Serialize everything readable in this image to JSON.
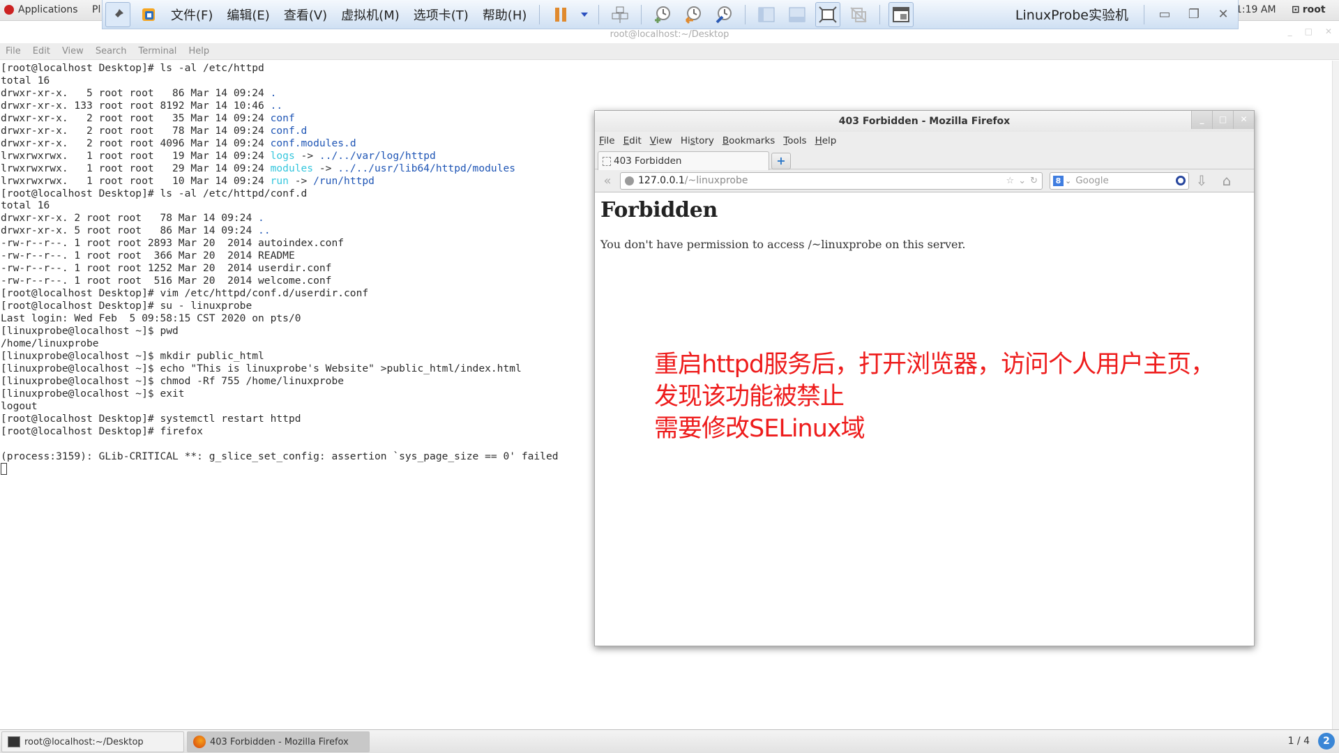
{
  "gnome_topbar": {
    "applications": "Applications",
    "places_truncated": "Pl",
    "clock": "1:19 AM",
    "user": "root"
  },
  "vm_toolbar": {
    "menus": [
      "文件(F)",
      "编辑(E)",
      "查看(V)",
      "虚拟机(M)",
      "选项卡(T)",
      "帮助(H)"
    ],
    "title": "LinuxProbe实验机",
    "icons": [
      "pin-icon",
      "vmware-logo-icon",
      "pause-icon",
      "dropdown-arrow-icon",
      "send-ctrl-alt-del-icon",
      "snapshot-take-icon",
      "snapshot-revert-icon",
      "snapshot-manager-icon",
      "sidebar-view-icon",
      "thumbnail-view-icon",
      "fullscreen-icon",
      "unity-icon",
      "console-view-icon"
    ],
    "minimize": "▭",
    "restore": "❐",
    "close": "✕"
  },
  "terminal": {
    "title": "root@localhost:~/Desktop",
    "menu": [
      "File",
      "Edit",
      "View",
      "Search",
      "Terminal",
      "Help"
    ],
    "lines": [
      [
        {
          "t": "[root@localhost Desktop]# ls -al /etc/httpd"
        }
      ],
      [
        {
          "t": "total 16"
        }
      ],
      [
        {
          "t": "drwxr-xr-x.   5 root root   86 Mar 14 09:24 "
        },
        {
          "t": ".",
          "c": "dir"
        }
      ],
      [
        {
          "t": "drwxr-xr-x. 133 root root 8192 Mar 14 10:46 "
        },
        {
          "t": "..",
          "c": "dir"
        }
      ],
      [
        {
          "t": "drwxr-xr-x.   2 root root   35 Mar 14 09:24 "
        },
        {
          "t": "conf",
          "c": "dir"
        }
      ],
      [
        {
          "t": "drwxr-xr-x.   2 root root   78 Mar 14 09:24 "
        },
        {
          "t": "conf.d",
          "c": "dir"
        }
      ],
      [
        {
          "t": "drwxr-xr-x.   2 root root 4096 Mar 14 09:24 "
        },
        {
          "t": "conf.modules.d",
          "c": "dir"
        }
      ],
      [
        {
          "t": "lrwxrwxrwx.   1 root root   19 Mar 14 09:24 "
        },
        {
          "t": "logs",
          "c": "lnk"
        },
        {
          "t": " -> "
        },
        {
          "t": "../../var/log/httpd",
          "c": "dir"
        }
      ],
      [
        {
          "t": "lrwxrwxrwx.   1 root root   29 Mar 14 09:24 "
        },
        {
          "t": "modules",
          "c": "lnk"
        },
        {
          "t": " -> "
        },
        {
          "t": "../../usr/lib64/httpd/modules",
          "c": "dir"
        }
      ],
      [
        {
          "t": "lrwxrwxrwx.   1 root root   10 Mar 14 09:24 "
        },
        {
          "t": "run",
          "c": "lnk"
        },
        {
          "t": " -> "
        },
        {
          "t": "/run/httpd",
          "c": "dir"
        }
      ],
      [
        {
          "t": "[root@localhost Desktop]# ls -al /etc/httpd/conf.d"
        }
      ],
      [
        {
          "t": "total 16"
        }
      ],
      [
        {
          "t": "drwxr-xr-x. 2 root root   78 Mar 14 09:24 "
        },
        {
          "t": ".",
          "c": "dir"
        }
      ],
      [
        {
          "t": "drwxr-xr-x. 5 root root   86 Mar 14 09:24 "
        },
        {
          "t": "..",
          "c": "dir"
        }
      ],
      [
        {
          "t": "-rw-r--r--. 1 root root 2893 Mar 20  2014 autoindex.conf"
        }
      ],
      [
        {
          "t": "-rw-r--r--. 1 root root  366 Mar 20  2014 README"
        }
      ],
      [
        {
          "t": "-rw-r--r--. 1 root root 1252 Mar 20  2014 userdir.conf"
        }
      ],
      [
        {
          "t": "-rw-r--r--. 1 root root  516 Mar 20  2014 welcome.conf"
        }
      ],
      [
        {
          "t": "[root@localhost Desktop]# vim /etc/httpd/conf.d/userdir.conf"
        }
      ],
      [
        {
          "t": "[root@localhost Desktop]# su - linuxprobe"
        }
      ],
      [
        {
          "t": "Last login: Wed Feb  5 09:58:15 CST 2020 on pts/0"
        }
      ],
      [
        {
          "t": "[linuxprobe@localhost ~]$ pwd"
        }
      ],
      [
        {
          "t": "/home/linuxprobe"
        }
      ],
      [
        {
          "t": "[linuxprobe@localhost ~]$ mkdir public_html"
        }
      ],
      [
        {
          "t": "[linuxprobe@localhost ~]$ echo \"This is linuxprobe's Website\" >public_html/index.html"
        }
      ],
      [
        {
          "t": "[linuxprobe@localhost ~]$ chmod -Rf 755 /home/linuxprobe"
        }
      ],
      [
        {
          "t": "[linuxprobe@localhost ~]$ exit"
        }
      ],
      [
        {
          "t": "logout"
        }
      ],
      [
        {
          "t": "[root@localhost Desktop]# systemctl restart httpd"
        }
      ],
      [
        {
          "t": "[root@localhost Desktop]# firefox"
        }
      ],
      [
        {
          "t": ""
        }
      ],
      [
        {
          "t": "(process:3159): GLib-CRITICAL **: g_slice_set_config: assertion `sys_page_size == 0' failed"
        }
      ]
    ]
  },
  "firefox": {
    "window_title": "403 Forbidden - Mozilla Firefox",
    "menu": [
      {
        "u": "F",
        "rest": "ile"
      },
      {
        "u": "E",
        "rest": "dit"
      },
      {
        "u": "V",
        "rest": "iew"
      },
      {
        "pre": "Hi",
        "u": "s",
        "rest": "tory"
      },
      {
        "u": "B",
        "rest": "ookmarks"
      },
      {
        "u": "T",
        "rest": "ools"
      },
      {
        "u": "H",
        "rest": "elp"
      }
    ],
    "tab_title": "403 Forbidden",
    "new_tab": "+",
    "url_host": "127.0.0.1",
    "url_path": "/~linuxprobe",
    "search_engine": "8",
    "search_placeholder": "Google",
    "page_heading": "Forbidden",
    "page_message": "You don't have permission to access /~linuxprobe on this server."
  },
  "annotation": {
    "lines": [
      "重启httpd服务后，打开浏览器，访问个人用户主页，",
      "发现该功能被禁止",
      "需要修改SELinux域"
    ],
    "color": "#ee1c1c"
  },
  "taskbar": {
    "items": [
      {
        "label": "root@localhost:~/Desktop",
        "active": false
      },
      {
        "label": "403 Forbidden - Mozilla Firefox",
        "active": true
      }
    ],
    "workspace": "1 / 4",
    "badge": "2"
  }
}
